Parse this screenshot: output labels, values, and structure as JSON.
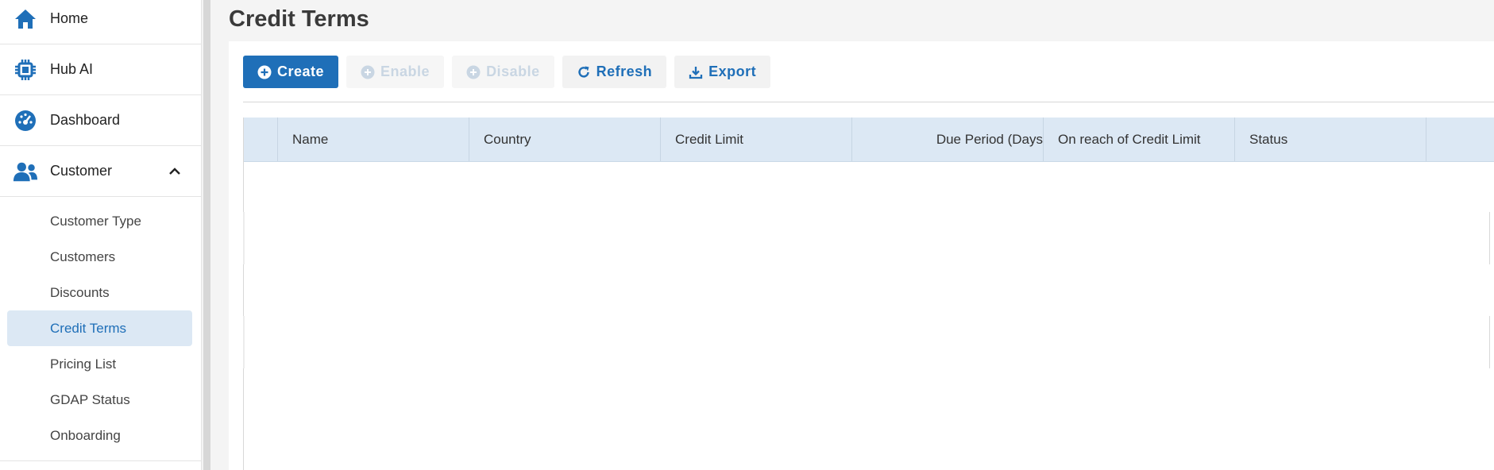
{
  "sidebar": {
    "items": [
      {
        "label": "Home",
        "icon": "home-icon"
      },
      {
        "label": "Hub AI",
        "icon": "chip-icon"
      },
      {
        "label": "Dashboard",
        "icon": "gauge-icon"
      },
      {
        "label": "Customer",
        "icon": "users-icon",
        "expanded": true
      }
    ],
    "sub_items": [
      {
        "label": "Customer Type"
      },
      {
        "label": "Customers"
      },
      {
        "label": "Discounts"
      },
      {
        "label": "Credit Terms",
        "active": true
      },
      {
        "label": "Pricing List"
      },
      {
        "label": "GDAP Status"
      },
      {
        "label": "Onboarding"
      }
    ]
  },
  "page": {
    "title": "Credit Terms"
  },
  "toolbar": {
    "create_label": "Create",
    "enable_label": "Enable",
    "disable_label": "Disable",
    "refresh_label": "Refresh",
    "export_label": "Export"
  },
  "grid": {
    "columns": [
      "Name",
      "Country",
      "Credit Limit",
      "Due Period (Days",
      "On reach of Credit Limit",
      "Status"
    ],
    "rows": []
  },
  "colors": {
    "accent": "#1f6fb8",
    "header_bg": "#dce8f4",
    "active_bg": "#dce8f4"
  }
}
